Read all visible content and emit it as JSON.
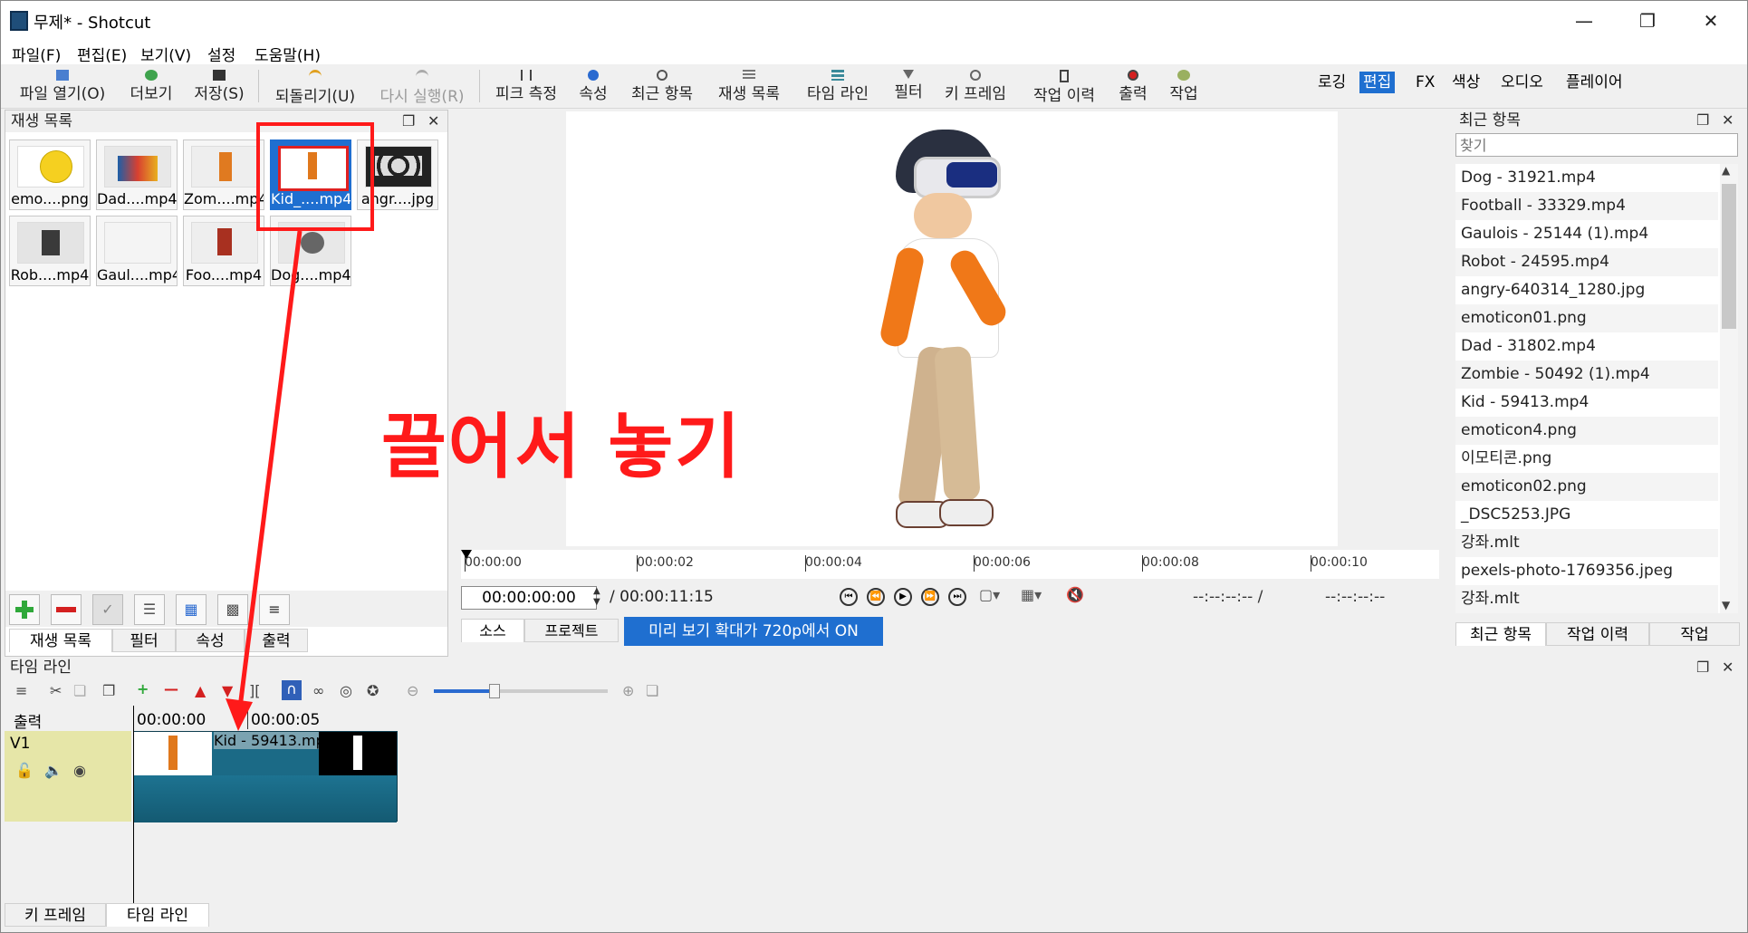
{
  "window": {
    "title": "무제* - Shotcut"
  },
  "menu": [
    "파일(F)",
    "편집(E)",
    "보기(V)",
    "설정",
    "도움말(H)"
  ],
  "toolbar": {
    "open": "파일 열기(O)",
    "more": "더보기",
    "save": "저장(S)",
    "undo": "되돌리기(U)",
    "redo": "다시 실행(R)",
    "peak": "피크 측정",
    "properties": "속성",
    "recent": "최근 항목",
    "playlist": "재생 목록",
    "timeline": "타임 라인",
    "filters": "필터",
    "keyframes": "키 프레임",
    "history": "작업 이력",
    "export": "출력",
    "jobs": "작업"
  },
  "layouts": [
    "로깅",
    "편집",
    "FX",
    "색상",
    "오디오",
    "플레이어"
  ],
  "layout_active": "편집",
  "playlist": {
    "title": "재생 목록",
    "items": [
      "emo....png",
      "Dad....mp4",
      "Zom....mp4",
      "Kid_....mp4",
      "angr....jpg",
      "Rob....mp4",
      "Gaul....mp4",
      "Foo....mp4",
      "Dog....mp4"
    ],
    "selected_index": 3,
    "tabs": [
      "재생 목록",
      "필터",
      "속성",
      "출력"
    ]
  },
  "annotation": {
    "text": "끌어서 놓기"
  },
  "player": {
    "ruler": [
      "00:00:00",
      "00:00:02",
      "00:00:04",
      "00:00:06",
      "00:00:08",
      "00:00:10"
    ],
    "timecode": "00:00:00:00",
    "duration": "/ 00:00:11:15",
    "in_point": "--:--:--:-- /",
    "out_point": "--:--:--:--",
    "tabs": [
      "소스",
      "프로젝트"
    ],
    "zoom_badge": "미리 보기 확대가 720p에서 ON"
  },
  "recent": {
    "title": "최근 항목",
    "search_placeholder": "찾기",
    "items": [
      "Dog - 31921.mp4",
      "Football - 33329.mp4",
      "Gaulois - 25144 (1).mp4",
      "Robot - 24595.mp4",
      "angry-640314_1280.jpg",
      "emoticon01.png",
      "Dad - 31802.mp4",
      "Zombie - 50492 (1).mp4",
      "Kid - 59413.mp4",
      "emoticon4.png",
      "이모티콘.png",
      "emoticon02.png",
      "_DSC5253.JPG",
      "강좌.mlt",
      "pexels-photo-1769356.jpeg",
      "강좌.mlt"
    ],
    "tabs": [
      "최근 항목",
      "작업 이력",
      "작업"
    ]
  },
  "timeline": {
    "title": "타임 라인",
    "output_label": "출력",
    "ruler": [
      "00:00:00",
      "00:00:05"
    ],
    "track": "V1",
    "clip": "Kid - 59413.mp4",
    "zoom_level": 0.35
  },
  "bottom_tabs": [
    "키 프레임",
    "타임 라인"
  ],
  "colors": {
    "accent": "#1f6fd0",
    "annotation": "#ff1a1a",
    "clip": "#1b6a86",
    "track_header": "#e6e6a8"
  }
}
